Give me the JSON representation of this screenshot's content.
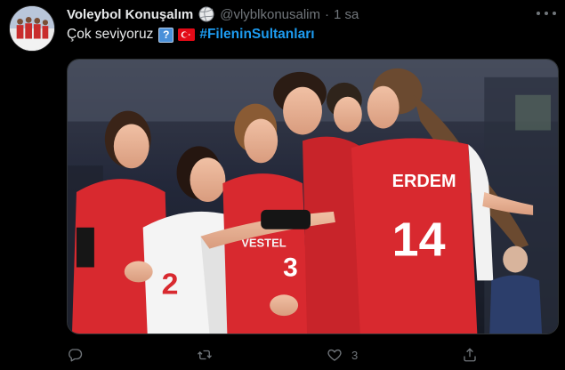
{
  "tweet": {
    "display_name": "Voleybol Konuşalım",
    "handle": "@vlyblkonusalim",
    "separator": "·",
    "time": "1 sa",
    "text_prefix": "Çok seviyoruz",
    "hashtag": "#FileninSultanları",
    "emoji_question": "?",
    "verified_badge_icon": "volleyball-icon",
    "image": {
      "jersey_back_name": "ERDEM",
      "jersey_back_number": "14",
      "jersey_front_number_left": "2",
      "jersey_front_number_mid": "3",
      "shorts_label": "VESTEL"
    },
    "actions": {
      "reply_icon": "reply-icon",
      "retweet_icon": "retweet-icon",
      "like_icon": "heart-icon",
      "like_count": "3",
      "share_icon": "share-icon"
    }
  },
  "colors": {
    "background": "#000000",
    "text": "#e7e9ea",
    "muted": "#71767b",
    "link": "#1d9bf0",
    "jersey_red": "#d8292f"
  }
}
